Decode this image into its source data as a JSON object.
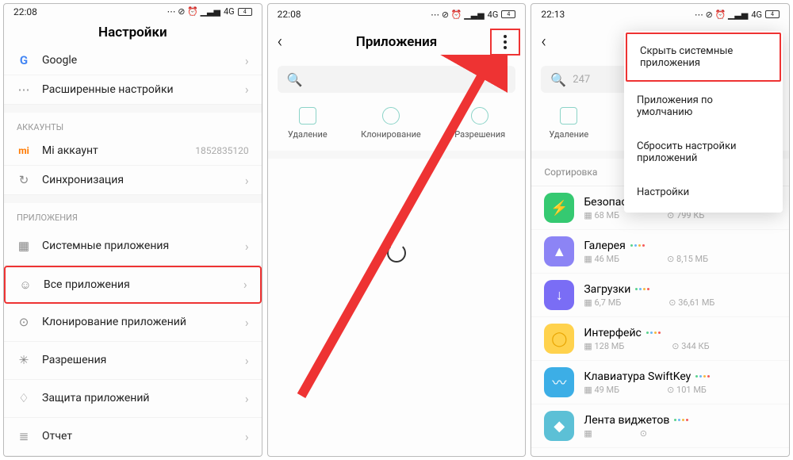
{
  "status": {
    "time1": "22:08",
    "time2": "22:08",
    "time3": "22:13",
    "net": "4G",
    "bat": "4"
  },
  "s1": {
    "title": "Настройки",
    "rows": [
      {
        "icon": "G",
        "iconColor": "#4285f4",
        "label": "Google"
      },
      {
        "icon": "⋯",
        "iconColor": "#888",
        "label": "Расширенные настройки"
      }
    ],
    "sections": {
      "accounts": "АККАУНТЫ",
      "apps": "ПРИЛОЖЕНИЯ"
    },
    "accountRows": [
      {
        "icon": "mi",
        "iconColor": "#ff7a00",
        "label": "Mi аккаунт",
        "value": "1852835120"
      },
      {
        "icon": "↻",
        "iconColor": "#888",
        "label": "Синхронизация"
      }
    ],
    "appRows": [
      {
        "icon": "▦",
        "label": "Системные приложения"
      },
      {
        "icon": "☺",
        "label": "Все приложения",
        "hl": true
      },
      {
        "icon": "⊙",
        "label": "Клонирование приложений"
      },
      {
        "icon": "✳",
        "label": "Разрешения"
      },
      {
        "icon": "♢",
        "label": "Защита приложений"
      },
      {
        "icon": "≣",
        "label": "Отчет"
      }
    ]
  },
  "s2": {
    "title": "Приложения",
    "tools": [
      {
        "label": "Удаление"
      },
      {
        "label": "Клонирование"
      },
      {
        "label": "Разрешения"
      }
    ]
  },
  "s3": {
    "searchCount": "247",
    "tools": [
      {
        "label": "Удаление"
      }
    ],
    "sortLabel": "Сортировка",
    "popup": [
      "Скрыть системные приложения",
      "Приложения по умолчанию",
      "Сбросить настройки приложений",
      "Настройки"
    ],
    "apps": [
      {
        "name": "Безопасность",
        "size": "68 МБ",
        "right": "799 КБ",
        "color": "#35c971",
        "glyph": "⚡"
      },
      {
        "name": "Галерея",
        "size": "46 МБ",
        "right": "8,15 МБ",
        "color": "#8c84f5",
        "glyph": "▲"
      },
      {
        "name": "Загрузки",
        "size": "6,7 МБ",
        "right": "36,61 МБ",
        "color": "#7a6df5",
        "glyph": "↓"
      },
      {
        "name": "Интерфейс",
        "size": "128 МБ",
        "right": "344 КБ",
        "color": "#ffd24d",
        "glyph": "◯",
        "fg": "#e8a400"
      },
      {
        "name": "Клавиатура SwiftKey",
        "size": "49 МБ",
        "right": "101 МБ",
        "color": "#3caee6",
        "glyph": "〰"
      },
      {
        "name": "Лента виджетов",
        "size": "",
        "right": "",
        "color": "#5cc0d6",
        "glyph": "◆"
      }
    ]
  }
}
